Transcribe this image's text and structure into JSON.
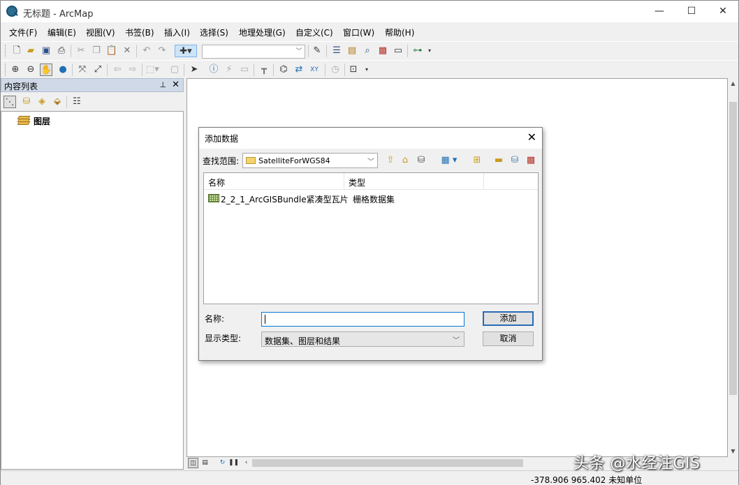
{
  "window": {
    "title": "无标题 - ArcMap",
    "minimize_glyph": "—",
    "maximize_glyph": "☐",
    "close_glyph": "✕"
  },
  "menu": [
    "文件(F)",
    "编辑(E)",
    "视图(V)",
    "书签(B)",
    "插入(I)",
    "选择(S)",
    "地理处理(G)",
    "自定义(C)",
    "窗口(W)",
    "帮助(H)"
  ],
  "toolbar1": {
    "icons": [
      "new-document-icon",
      "open-folder-icon",
      "save-icon",
      "print-icon",
      "cut-icon",
      "copy-icon",
      "paste-icon",
      "delete-icon",
      "undo-icon",
      "redo-icon",
      "add-data-icon",
      "editor-icon",
      "table-of-contents-icon",
      "catalog-icon",
      "search-window-icon",
      "arctoolbox-icon",
      "python-icon",
      "model-builder-icon"
    ],
    "scale_value": ""
  },
  "toolbar2": {
    "icons": [
      "zoom-in-icon",
      "zoom-out-icon",
      "pan-icon",
      "full-extent-icon",
      "fixed-zoom-in-icon",
      "fixed-zoom-out-icon",
      "back-extent-icon",
      "forward-extent-icon",
      "select-features-icon",
      "clear-selection-icon",
      "select-elements-icon",
      "identify-icon",
      "hyperlink-icon",
      "html-popup-icon",
      "measure-icon",
      "find-icon",
      "find-route-icon",
      "go-to-xy-icon",
      "time-slider-icon",
      "viewer-window-icon"
    ]
  },
  "toc": {
    "title": "内容列表",
    "pin_glyph": "⊥",
    "close_glyph": "✕",
    "layer_label": "图层"
  },
  "dialog": {
    "title": "添加数据",
    "close_glyph": "✕",
    "look_in_label": "查找范围:",
    "look_in_value": "SatelliteForWGS84",
    "columns": [
      "名称",
      "类型"
    ],
    "files": [
      {
        "name": "2_2_1_ArcGISBundle紧凑型瓦片",
        "type": "栅格数据集"
      }
    ],
    "name_label": "名称:",
    "name_value": "",
    "show_type_label": "显示类型:",
    "show_type_value": "数据集、图层和结果",
    "add_button": "添加",
    "cancel_button": "取消"
  },
  "status": {
    "coordinates": "-378.906  965.402 未知单位"
  },
  "watermark": "头条 @水经注GIS"
}
